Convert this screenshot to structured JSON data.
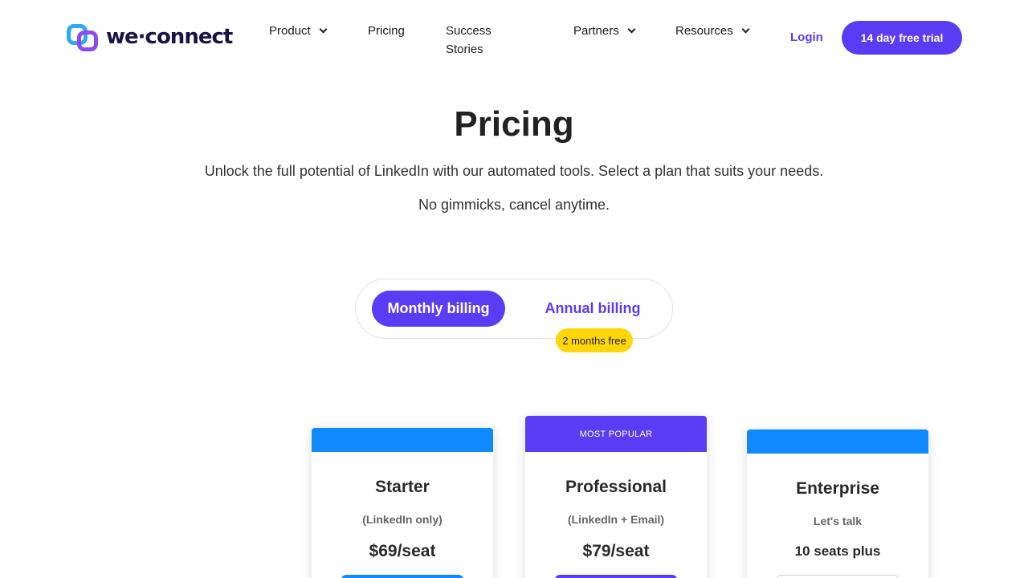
{
  "brand": {
    "name": "we·connect",
    "icon": "linked-rings-logo"
  },
  "nav": {
    "items": [
      {
        "label": "Product",
        "has_dropdown": true
      },
      {
        "label": "Pricing",
        "has_dropdown": false
      },
      {
        "label": "Success\nStories",
        "has_dropdown": false
      },
      {
        "label": "Partners",
        "has_dropdown": true
      },
      {
        "label": "Resources",
        "has_dropdown": true
      }
    ],
    "login_label": "Login",
    "trial_label": "14 day free trial"
  },
  "hero": {
    "title": "Pricing",
    "subtitle": "Unlock the full potential of LinkedIn with our automated tools. Select a plan that suits your needs.",
    "subtitle2": "No gimmicks, cancel anytime."
  },
  "billing": {
    "monthly_label": "Monthly billing",
    "annual_label": "Annual billing",
    "annual_badge": "2 months free",
    "selected": "monthly"
  },
  "plans": [
    {
      "name": "Starter",
      "sub": "(LinkedIn only)",
      "price": "$69/seat",
      "banner": ""
    },
    {
      "name": "Professional",
      "sub": "(LinkedIn + Email)",
      "price": "$79/seat",
      "banner": "MOST POPULAR"
    },
    {
      "name": "Enterprise",
      "sub": "Let's talk",
      "price": "10 seats plus",
      "banner": ""
    }
  ],
  "colors": {
    "accent": "#5b3cf5",
    "blue": "#1089ff",
    "badge": "#ffd60a"
  }
}
